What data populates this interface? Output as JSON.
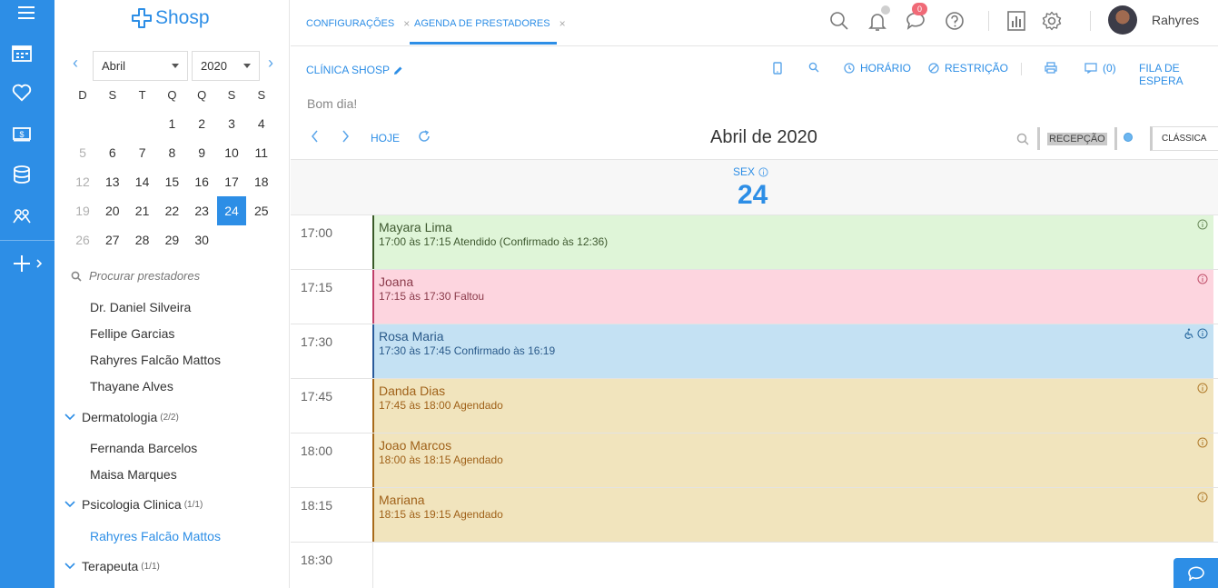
{
  "app": {
    "logo": "Shosp"
  },
  "sidebar": {
    "month_select": "Abril",
    "year_select": "2020",
    "weekdays": [
      "D",
      "S",
      "T",
      "Q",
      "Q",
      "S",
      "S"
    ],
    "weeks": [
      [
        {
          "d": ""
        },
        {
          "d": ""
        },
        {
          "d": ""
        },
        {
          "d": "1"
        },
        {
          "d": "2"
        },
        {
          "d": "3"
        },
        {
          "d": "4"
        }
      ],
      [
        {
          "d": "5",
          "muted": true
        },
        {
          "d": "6"
        },
        {
          "d": "7"
        },
        {
          "d": "8"
        },
        {
          "d": "9"
        },
        {
          "d": "10"
        },
        {
          "d": "11"
        }
      ],
      [
        {
          "d": "12",
          "muted": true
        },
        {
          "d": "13"
        },
        {
          "d": "14"
        },
        {
          "d": "15"
        },
        {
          "d": "16"
        },
        {
          "d": "17"
        },
        {
          "d": "18"
        }
      ],
      [
        {
          "d": "19",
          "muted": true
        },
        {
          "d": "20"
        },
        {
          "d": "21"
        },
        {
          "d": "22"
        },
        {
          "d": "23"
        },
        {
          "d": "24",
          "selected": true
        },
        {
          "d": "25"
        }
      ],
      [
        {
          "d": "26",
          "muted": true
        },
        {
          "d": "27"
        },
        {
          "d": "28"
        },
        {
          "d": "29"
        },
        {
          "d": "30"
        },
        {
          "d": ""
        },
        {
          "d": ""
        }
      ]
    ],
    "search_placeholder": "Procurar prestadores",
    "providers": [
      "Dr. Daniel Silveira",
      "Fellipe Garcias",
      "Rahyres Falcão Mattos",
      "Thayane Alves"
    ],
    "groups": [
      {
        "name": "Dermatologia",
        "count": "(2/2)",
        "members": [
          "Fernanda Barcelos",
          "Maisa Marques"
        ]
      },
      {
        "name": "Psicologia Clinica",
        "count": "(1/1)",
        "members": [
          "Rahyres Falcão Mattos"
        ]
      },
      {
        "name": "Terapeuta",
        "count": "(1/1)",
        "members": []
      }
    ]
  },
  "topbar": {
    "tabs": [
      {
        "label": "CONFIGURAÇÕES",
        "close": "×"
      },
      {
        "label": "AGENDA DE PRESTADORES",
        "close": "×"
      }
    ],
    "messages_badge": "0",
    "user_name": "Rahyres"
  },
  "toolbar": {
    "clinic": "CLÍNICA SHOSP",
    "horario": "HORÁRIO",
    "restricao": "RESTRIÇÃO",
    "chat_count": "(0)",
    "fila": "FILA DE ESPERA"
  },
  "greeting": "Bom dia!",
  "calendar": {
    "today_label": "HOJE",
    "title": "Abril de 2020",
    "recepcao": "RECEPÇÃO",
    "view_select": "CLÁSSICA",
    "day_of_week": "SEX",
    "day_number": "24"
  },
  "appointments": [
    {
      "time": "17:00",
      "name": "Mayara Lima",
      "info": "17:00 às 17:15 Atendido (Confirmado às 12:36)",
      "bg": "#dff5d8",
      "border": "#3a5a28",
      "text": "#3f5a30",
      "icon": "#6a8a5a"
    },
    {
      "time": "17:15",
      "name": "Joana",
      "info": "17:15 às 17:30 Faltou",
      "bg": "#fdd5df",
      "border": "#c0406a",
      "text": "#8a3a4a",
      "icon": "#c0506a"
    },
    {
      "time": "17:30",
      "name": "Rosa Maria",
      "info": "17:30 às 17:45 Confirmado às 16:19",
      "bg": "#c4e1f3",
      "border": "#2a5a9a",
      "text": "#2a5a8a",
      "icon": "#2a6aa0"
    },
    {
      "time": "17:45",
      "name": "Danda Dias",
      "info": "17:45 às 18:00 Agendado",
      "bg": "#f1e4bd",
      "border": "#a86a1a",
      "text": "#a0621a",
      "icon": "#b07a2a"
    },
    {
      "time": "18:00",
      "name": "Joao Marcos",
      "info": "18:00 às 18:15 Agendado",
      "bg": "#f1e4bd",
      "border": "#a86a1a",
      "text": "#a0621a",
      "icon": "#b07a2a"
    },
    {
      "time": "18:15",
      "name": "Mariana",
      "info": "18:15 às 19:15 Agendado",
      "bg": "#f1e4bd",
      "border": "#a86a1a",
      "text": "#a0621a",
      "icon": "#b07a2a"
    }
  ],
  "last_time": "18:30",
  "colors": {
    "accent": "#2d8ee6"
  }
}
